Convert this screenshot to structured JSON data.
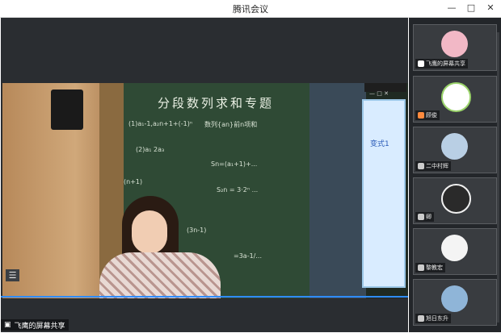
{
  "window": {
    "title": "腾讯会议",
    "min": "—",
    "max": "□",
    "close": "✕"
  },
  "board": {
    "title": "分段数列求和专题",
    "lines": [
      "(1)a₁-1,a₂n+1+(-1)ⁿ",
      "(2)a₁ 2a₃",
      "数列{an}前n项和",
      "Sn=(a₁+1)+...",
      "S₂n = 3·2ⁿ ...",
      "(n+1)",
      "=3a-1/...",
      "(3n-1)"
    ]
  },
  "presenter": {
    "label": "飞鹰的屏幕共享"
  },
  "monitor_text": "变式1",
  "participants": [
    {
      "name": "飞鹰的屏幕共享",
      "color": "#f2b8c6",
      "accent": "#ff8a3d"
    },
    {
      "name": "顾俊",
      "color": "#ffffff",
      "accent": "#ff8a3d"
    },
    {
      "name": "二中村辉",
      "color": "#b9cfe4",
      "accent": "#cccccc"
    },
    {
      "name": "卿",
      "color": "#2a2a2a",
      "accent": "#cccccc"
    },
    {
      "name": "黎教宏",
      "color": "#f4f4f4",
      "accent": "#cccccc"
    },
    {
      "name": "旭日东升",
      "color": "#8fb5d8",
      "accent": "#cccccc"
    }
  ]
}
